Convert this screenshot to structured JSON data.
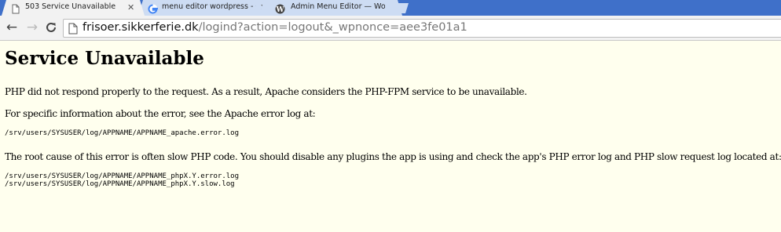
{
  "browser": {
    "tabs": [
      {
        "title": "503 Service Unavailable",
        "icon": "page-icon",
        "active": true
      },
      {
        "title": "menu editor wordpress - Goo",
        "icon": "google-icon",
        "active": false
      },
      {
        "title": "Admin Menu Editor — Word",
        "icon": "wordpress-icon",
        "active": false
      }
    ],
    "close_glyph": "✕",
    "url_host": "frisoer.sikkerferie.dk",
    "url_path": "/logind?action=logout&_wpnonce=aee3fe01a1",
    "colors": {
      "tabstrip": "#3f70c9",
      "page_background": "#ffffee"
    }
  },
  "page": {
    "heading": "Service Unavailable",
    "paragraph_1": "PHP did not respond properly to the request. As a result, Apache considers the PHP-FPM service to be unavailable.",
    "paragraph_2": "For specific information about the error, see the Apache error log at:",
    "apache_log_path": "/srv/users/SYSUSER/log/APPNAME/APPNAME_apache.error.log",
    "paragraph_3": "The root cause of this error is often slow PHP code. You should disable any plugins the app is using and check the app's PHP error log and PHP slow request log located at:",
    "php_log_paths": "/srv/users/SYSUSER/log/APPNAME/APPNAME_phpX.Y.error.log\n/srv/users/SYSUSER/log/APPNAME/APPNAME_phpX.Y.slow.log"
  }
}
